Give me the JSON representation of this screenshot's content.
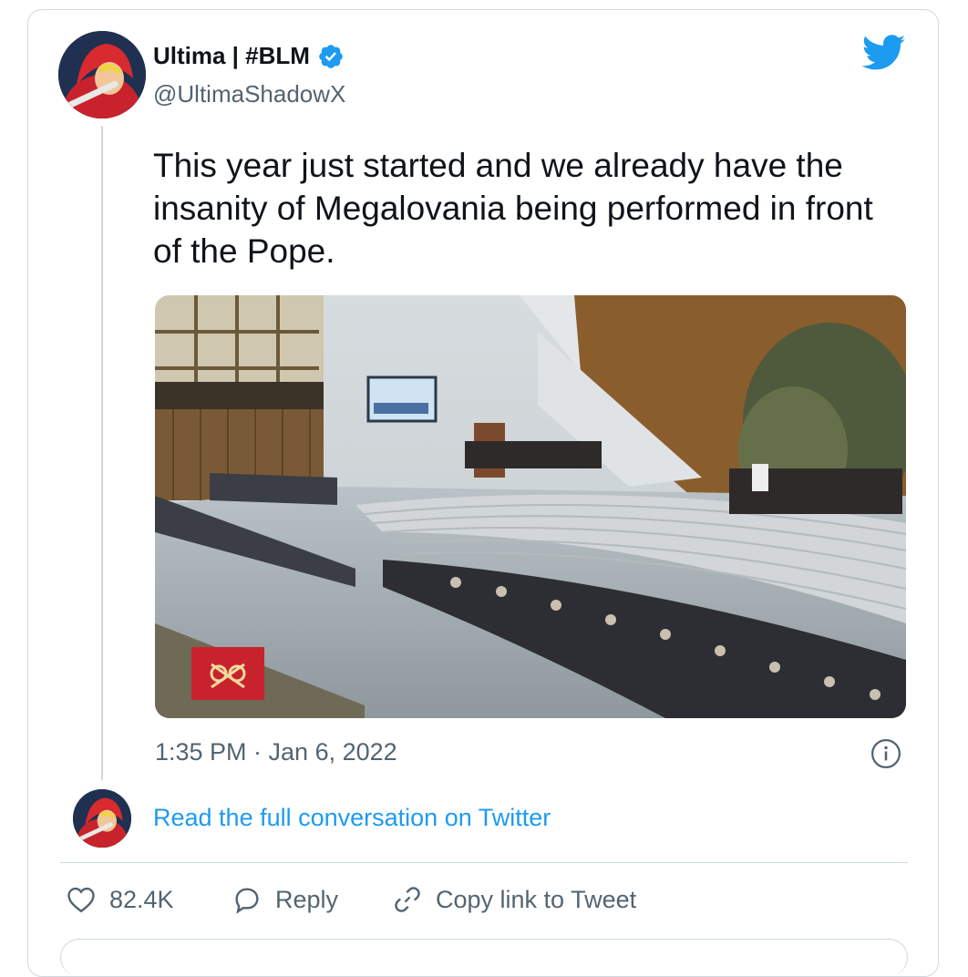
{
  "tweet": {
    "display_name": "Ultima | #BLM",
    "handle": "@UltimaShadowX",
    "text": "This year just started and we already have the insanity of Megalovania being performed in front of the Pope.",
    "timestamp": "1:35 PM · Jan 6, 2022"
  },
  "icons": {
    "brand": "twitter-bird-icon",
    "verified": "verified-badge-icon",
    "info": "info-icon",
    "like": "heart-icon",
    "reply": "reply-bubble-icon",
    "copy": "link-icon"
  },
  "conversation": {
    "link_label": "Read the full conversation on Twitter"
  },
  "actions": {
    "likes": "82.4K",
    "reply_label": "Reply",
    "copy_label": "Copy link to Tweet"
  },
  "colors": {
    "twitter_blue": "#1d9bf0",
    "text_secondary": "#536471",
    "border": "#cfd9de"
  }
}
